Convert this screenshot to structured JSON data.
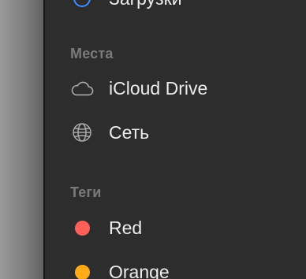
{
  "sidebar": {
    "partial_item": {
      "label": "Загрузки",
      "icon": "downloads-icon",
      "color": "#3b8cff"
    },
    "places_header": "Места",
    "places": [
      {
        "label": "iCloud Drive",
        "icon": "icloud-icon"
      },
      {
        "label": "Сеть",
        "icon": "network-globe-icon"
      }
    ],
    "tags_header": "Теги",
    "tags": [
      {
        "label": "Red",
        "color": "#fe6059"
      },
      {
        "label": "Orange",
        "color": "#ffaa18"
      }
    ]
  }
}
